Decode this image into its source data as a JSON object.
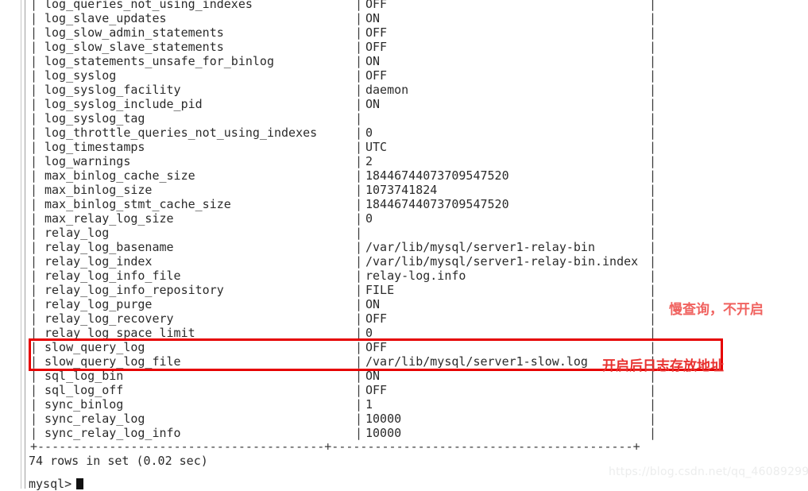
{
  "terminal": {
    "prompt": "mysql>",
    "result_line": "74 rows in set (0.02 sec)",
    "bottom_rule": "+----------------------------------------+------------------------------------------+",
    "column_separator": "|",
    "rows": [
      {
        "name": "log_queries_not_using_indexes",
        "value": "OFF"
      },
      {
        "name": "log_slave_updates",
        "value": "ON"
      },
      {
        "name": "log_slow_admin_statements",
        "value": "OFF"
      },
      {
        "name": "log_slow_slave_statements",
        "value": "OFF"
      },
      {
        "name": "log_statements_unsafe_for_binlog",
        "value": "ON"
      },
      {
        "name": "log_syslog",
        "value": "OFF"
      },
      {
        "name": "log_syslog_facility",
        "value": "daemon"
      },
      {
        "name": "log_syslog_include_pid",
        "value": "ON"
      },
      {
        "name": "log_syslog_tag",
        "value": ""
      },
      {
        "name": "log_throttle_queries_not_using_indexes",
        "value": "0"
      },
      {
        "name": "log_timestamps",
        "value": "UTC"
      },
      {
        "name": "log_warnings",
        "value": "2"
      },
      {
        "name": "max_binlog_cache_size",
        "value": "18446744073709547520"
      },
      {
        "name": "max_binlog_size",
        "value": "1073741824"
      },
      {
        "name": "max_binlog_stmt_cache_size",
        "value": "18446744073709547520"
      },
      {
        "name": "max_relay_log_size",
        "value": "0"
      },
      {
        "name": "relay_log",
        "value": ""
      },
      {
        "name": "relay_log_basename",
        "value": "/var/lib/mysql/server1-relay-bin"
      },
      {
        "name": "relay_log_index",
        "value": "/var/lib/mysql/server1-relay-bin.index"
      },
      {
        "name": "relay_log_info_file",
        "value": "relay-log.info"
      },
      {
        "name": "relay_log_info_repository",
        "value": "FILE"
      },
      {
        "name": "relay_log_purge",
        "value": "ON"
      },
      {
        "name": "relay_log_recovery",
        "value": "OFF"
      },
      {
        "name": "relay_log_space_limit",
        "value": "0"
      },
      {
        "name": "slow_query_log",
        "value": "OFF"
      },
      {
        "name": "slow_query_log_file",
        "value": "/var/lib/mysql/server1-slow.log"
      },
      {
        "name": "sql_log_bin",
        "value": "ON"
      },
      {
        "name": "sql_log_off",
        "value": "OFF"
      },
      {
        "name": "sync_binlog",
        "value": "1"
      },
      {
        "name": "sync_relay_log",
        "value": "10000"
      },
      {
        "name": "sync_relay_log_info",
        "value": "10000"
      }
    ]
  },
  "annotations": {
    "slow_query_note": "慢查询，不开启",
    "log_path_note": "开启后日志存放地址",
    "highlight_color": "#e60000",
    "note_color": "#e8312f"
  },
  "watermark": {
    "text": "https://blog.csdn.net/qq_46089299"
  }
}
